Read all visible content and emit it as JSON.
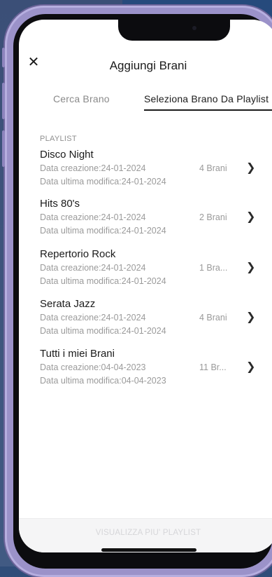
{
  "header": {
    "title": "Aggiungi Brani",
    "close_icon": "close-icon"
  },
  "tabs": [
    {
      "label": "Cerca Brano",
      "active": false
    },
    {
      "label": "Seleziona Brano Da Playlist",
      "active": true
    }
  ],
  "section_label": "PLAYLIST",
  "playlists": [
    {
      "name": "Disco Night",
      "created": "Data creazione:24-01-2024",
      "modified": "Data ultima modifica:24-01-2024",
      "count": "4 Brani"
    },
    {
      "name": "Hits 80's",
      "created": "Data creazione:24-01-2024",
      "modified": "Data ultima modifica:24-01-2024",
      "count": "2 Brani"
    },
    {
      "name": "Repertorio Rock",
      "created": "Data creazione:24-01-2024",
      "modified": "Data ultima modifica:24-01-2024",
      "count": "1 Bra..."
    },
    {
      "name": "Serata Jazz",
      "created": "Data creazione:24-01-2024",
      "modified": "Data ultima modifica:24-01-2024",
      "count": "4 Brani"
    },
    {
      "name": "Tutti i miei Brani",
      "created": "Data creazione:04-04-2023",
      "modified": "Data ultima modifica:04-04-2023",
      "count": "11 Br..."
    }
  ],
  "footer": {
    "button_label": "VISUALIZZA PIU' PLAYLIST"
  },
  "icons": {
    "chevron": "chevron-right-icon",
    "camera": "front-camera-icon"
  }
}
